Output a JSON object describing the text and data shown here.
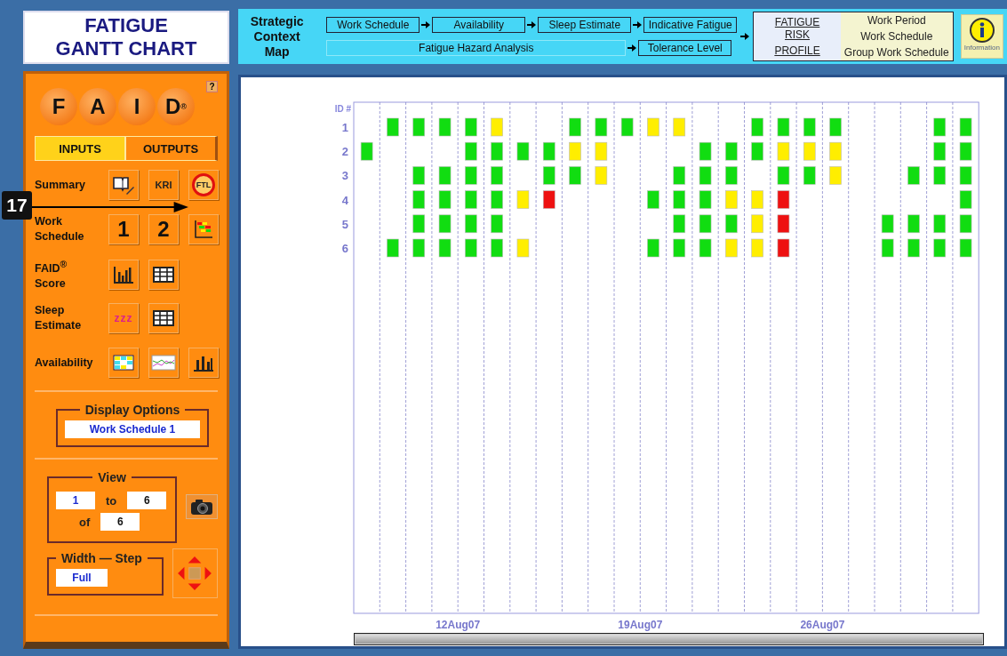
{
  "title_lines": [
    "FATIGUE",
    "GANTT CHART"
  ],
  "context_map": {
    "label": "Strategic Context Map",
    "flow_row_1": [
      "Work Schedule",
      "Availability",
      "Sleep Estimate",
      "Indicative Fatigue"
    ],
    "flow_row_2": [
      "Fatigue  Hazard  Analysis",
      "Tolerance Level"
    ],
    "risk_profile": {
      "label_lines": [
        "FATIGUE RISK",
        "PROFILE"
      ],
      "options": [
        "Work Period",
        "Work Schedule",
        "Group Work Schedule"
      ]
    },
    "info_button": {
      "label": "Information"
    }
  },
  "sidebar": {
    "logo_letters": [
      "F",
      "A",
      "I",
      "D"
    ],
    "logo_mark": "®",
    "help": "?",
    "tabs": [
      {
        "label": "INPUTS",
        "selected": false
      },
      {
        "label": "OUTPUTS",
        "selected": true
      }
    ],
    "output_rows": [
      {
        "label": "Summary",
        "buttons": [
          {
            "kind": "book"
          },
          {
            "kind": "text",
            "label": "KRI"
          },
          {
            "kind": "ftl",
            "label": "FTL"
          }
        ]
      },
      {
        "label": "Work Schedule",
        "buttons": [
          {
            "kind": "big",
            "label": "1"
          },
          {
            "kind": "big",
            "label": "2"
          },
          {
            "kind": "gantt"
          }
        ]
      },
      {
        "label": "FAID$^{®}$ Score",
        "buttons": [
          {
            "kind": "bars"
          },
          {
            "kind": "table"
          }
        ]
      },
      {
        "label": "Sleep Estimate",
        "buttons": [
          {
            "kind": "sleep",
            "label": "zzz"
          },
          {
            "kind": "table"
          }
        ]
      },
      {
        "label": "Availability",
        "buttons": [
          {
            "kind": "grid"
          },
          {
            "kind": "thumb"
          },
          {
            "kind": "stacked"
          }
        ]
      }
    ],
    "display_options": {
      "legend": "Display Options",
      "value": "Work Schedule 1"
    },
    "view": {
      "legend": "View",
      "from": "1",
      "to_label": "to",
      "to": "6",
      "of_label": "of",
      "total": "6"
    },
    "width_step": {
      "legend_1": "Width",
      "separator": "—",
      "legend_2": "Step",
      "value": "Full"
    }
  },
  "callout": {
    "number": "17"
  },
  "gantt": {
    "id_heading": "ID #",
    "date_labels": [
      "12Aug07",
      "19Aug07",
      "26Aug07"
    ],
    "rows": [
      {
        "id": "1",
        "shifts": [
          {
            "kind": "rest"
          },
          {
            "kind": "shift",
            "color": "#11dd11"
          },
          {
            "kind": "shift",
            "color": "#11dd11"
          },
          {
            "kind": "shift",
            "color": "#11dd11"
          },
          {
            "kind": "shift",
            "color": "#11dd11"
          },
          {
            "kind": "shift",
            "color": "#ffee00"
          },
          {
            "kind": "rest"
          },
          {
            "kind": "rest"
          },
          {
            "kind": "shift",
            "color": "#11dd11"
          },
          {
            "kind": "shift",
            "color": "#11dd11"
          },
          {
            "kind": "shift",
            "color": "#11dd11"
          },
          {
            "kind": "shift",
            "color": "#ffee00"
          },
          {
            "kind": "shift",
            "color": "#ffee00"
          },
          {
            "kind": "rest"
          },
          {
            "kind": "rest"
          },
          {
            "kind": "shift",
            "color": "#11dd11"
          },
          {
            "kind": "shift",
            "color": "#11dd11"
          },
          {
            "kind": "shift",
            "color": "#11dd11"
          },
          {
            "kind": "shift",
            "color": "#11dd11"
          },
          {
            "kind": "rest"
          },
          {
            "kind": "rest"
          },
          {
            "kind": "rest"
          },
          {
            "kind": "shift",
            "color": "#11dd11"
          },
          {
            "kind": "shift",
            "color": "#11dd11"
          }
        ]
      },
      {
        "id": "2",
        "shifts": [
          {
            "kind": "shift",
            "color": "#11dd11"
          },
          {
            "kind": "rest"
          },
          {
            "kind": "rest"
          },
          {
            "kind": "rest"
          },
          {
            "kind": "shift",
            "color": "#11dd11"
          },
          {
            "kind": "shift",
            "color": "#11dd11"
          },
          {
            "kind": "shift",
            "color": "#11dd11"
          },
          {
            "kind": "shift",
            "color": "#11dd11"
          },
          {
            "kind": "shift",
            "color": "#ffee00"
          },
          {
            "kind": "shift",
            "color": "#ffee00"
          },
          {
            "kind": "rest"
          },
          {
            "kind": "rest"
          },
          {
            "kind": "rest"
          },
          {
            "kind": "shift",
            "color": "#11dd11"
          },
          {
            "kind": "shift",
            "color": "#11dd11"
          },
          {
            "kind": "shift",
            "color": "#11dd11"
          },
          {
            "kind": "shift",
            "color": "#ffee00"
          },
          {
            "kind": "shift",
            "color": "#ffee00"
          },
          {
            "kind": "shift",
            "color": "#ffee00"
          },
          {
            "kind": "rest"
          },
          {
            "kind": "rest"
          },
          {
            "kind": "rest"
          },
          {
            "kind": "shift",
            "color": "#11dd11"
          },
          {
            "kind": "shift",
            "color": "#11dd11"
          }
        ]
      },
      {
        "id": "3",
        "shifts": [
          {
            "kind": "rest"
          },
          {
            "kind": "rest"
          },
          {
            "kind": "shift",
            "color": "#11dd11"
          },
          {
            "kind": "shift",
            "color": "#11dd11"
          },
          {
            "kind": "shift",
            "color": "#11dd11"
          },
          {
            "kind": "shift",
            "color": "#11dd11"
          },
          {
            "kind": "rest"
          },
          {
            "kind": "shift",
            "color": "#11dd11"
          },
          {
            "kind": "shift",
            "color": "#11dd11"
          },
          {
            "kind": "shift",
            "color": "#ffee00"
          },
          {
            "kind": "rest"
          },
          {
            "kind": "rest"
          },
          {
            "kind": "shift",
            "color": "#11dd11"
          },
          {
            "kind": "shift",
            "color": "#11dd11"
          },
          {
            "kind": "shift",
            "color": "#11dd11"
          },
          {
            "kind": "rest"
          },
          {
            "kind": "shift",
            "color": "#11dd11"
          },
          {
            "kind": "shift",
            "color": "#11dd11"
          },
          {
            "kind": "shift",
            "color": "#ffee00"
          },
          {
            "kind": "rest"
          },
          {
            "kind": "rest"
          },
          {
            "kind": "shift",
            "color": "#11dd11"
          },
          {
            "kind": "shift",
            "color": "#11dd11"
          },
          {
            "kind": "shift",
            "color": "#11dd11"
          }
        ]
      },
      {
        "id": "4",
        "shifts": [
          {
            "kind": "rest"
          },
          {
            "kind": "rest"
          },
          {
            "kind": "shift",
            "color": "#11dd11"
          },
          {
            "kind": "shift",
            "color": "#11dd11"
          },
          {
            "kind": "shift",
            "color": "#11dd11"
          },
          {
            "kind": "shift",
            "color": "#11dd11"
          },
          {
            "kind": "shift",
            "color": "#ffee00"
          },
          {
            "kind": "shift",
            "color": "#ee1111"
          },
          {
            "kind": "rest"
          },
          {
            "kind": "rest"
          },
          {
            "kind": "rest"
          },
          {
            "kind": "shift",
            "color": "#11dd11"
          },
          {
            "kind": "shift",
            "color": "#11dd11"
          },
          {
            "kind": "shift",
            "color": "#11dd11"
          },
          {
            "kind": "shift",
            "color": "#ffee00"
          },
          {
            "kind": "shift",
            "color": "#ffee00"
          },
          {
            "kind": "shift",
            "color": "#ee1111"
          },
          {
            "kind": "rest"
          },
          {
            "kind": "rest"
          },
          {
            "kind": "rest"
          },
          {
            "kind": "rest"
          },
          {
            "kind": "rest"
          },
          {
            "kind": "rest"
          },
          {
            "kind": "shift",
            "color": "#11dd11"
          }
        ]
      },
      {
        "id": "5",
        "shifts": [
          {
            "kind": "rest"
          },
          {
            "kind": "rest"
          },
          {
            "kind": "shift",
            "color": "#11dd11"
          },
          {
            "kind": "shift",
            "color": "#11dd11"
          },
          {
            "kind": "shift",
            "color": "#11dd11"
          },
          {
            "kind": "shift",
            "color": "#11dd11"
          },
          {
            "kind": "rest"
          },
          {
            "kind": "rest"
          },
          {
            "kind": "rest"
          },
          {
            "kind": "rest"
          },
          {
            "kind": "rest"
          },
          {
            "kind": "rest"
          },
          {
            "kind": "shift",
            "color": "#11dd11"
          },
          {
            "kind": "shift",
            "color": "#11dd11"
          },
          {
            "kind": "shift",
            "color": "#11dd11"
          },
          {
            "kind": "shift",
            "color": "#ffee00"
          },
          {
            "kind": "shift",
            "color": "#ee1111"
          },
          {
            "kind": "rest"
          },
          {
            "kind": "rest"
          },
          {
            "kind": "rest"
          },
          {
            "kind": "shift",
            "color": "#11dd11"
          },
          {
            "kind": "shift",
            "color": "#11dd11"
          },
          {
            "kind": "shift",
            "color": "#11dd11"
          },
          {
            "kind": "shift",
            "color": "#11dd11"
          }
        ]
      },
      {
        "id": "6",
        "shifts": [
          {
            "kind": "rest"
          },
          {
            "kind": "shift",
            "color": "#11dd11"
          },
          {
            "kind": "shift",
            "color": "#11dd11"
          },
          {
            "kind": "shift",
            "color": "#11dd11"
          },
          {
            "kind": "shift",
            "color": "#11dd11"
          },
          {
            "kind": "shift",
            "color": "#11dd11"
          },
          {
            "kind": "shift",
            "color": "#ffee00"
          },
          {
            "kind": "rest"
          },
          {
            "kind": "rest"
          },
          {
            "kind": "rest"
          },
          {
            "kind": "rest"
          },
          {
            "kind": "shift",
            "color": "#11dd11"
          },
          {
            "kind": "shift",
            "color": "#11dd11"
          },
          {
            "kind": "shift",
            "color": "#11dd11"
          },
          {
            "kind": "shift",
            "color": "#ffee00"
          },
          {
            "kind": "shift",
            "color": "#ffee00"
          },
          {
            "kind": "shift",
            "color": "#ee1111"
          },
          {
            "kind": "rest"
          },
          {
            "kind": "rest"
          },
          {
            "kind": "rest"
          },
          {
            "kind": "shift",
            "color": "#11dd11"
          },
          {
            "kind": "shift",
            "color": "#11dd11"
          },
          {
            "kind": "shift",
            "color": "#11dd11"
          },
          {
            "kind": "shift",
            "color": "#11dd11"
          }
        ]
      }
    ]
  }
}
